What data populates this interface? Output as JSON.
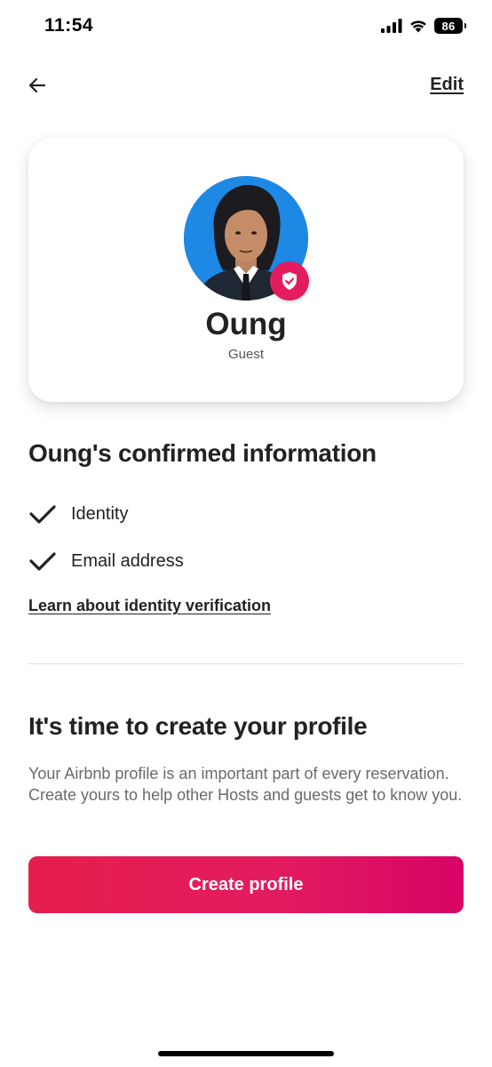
{
  "status_bar": {
    "time": "11:54",
    "battery": "86"
  },
  "nav": {
    "edit_label": "Edit"
  },
  "profile": {
    "name": "Oung",
    "role": "Guest",
    "avatar_color": "#1e88e5",
    "badge_color": "#e31c5f"
  },
  "confirmed": {
    "heading": "Oung's confirmed information",
    "items": [
      {
        "label": "Identity",
        "icon": "checkmark-icon"
      },
      {
        "label": "Email address",
        "icon": "checkmark-icon"
      }
    ],
    "learn_link": "Learn about identity verification"
  },
  "create_profile": {
    "heading": "It's time to create your profile",
    "body": "Your Airbnb profile is an important part of every reservation. Create yours to help other Hosts and guests get to know you.",
    "button_label": "Create profile",
    "button_color": "#e31c5f"
  }
}
